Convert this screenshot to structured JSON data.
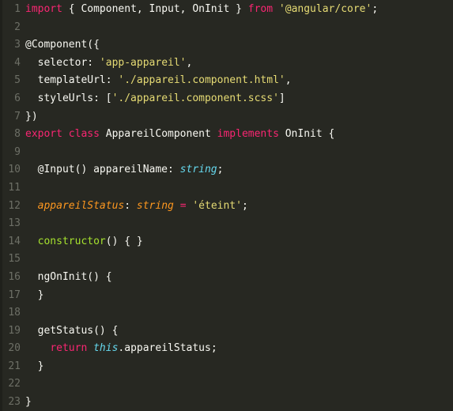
{
  "editor": {
    "language": "TypeScript",
    "theme": "Monokai",
    "colors": {
      "background": "#272822",
      "gutter_text": "#6d6f66",
      "foreground": "#f8f8f2",
      "keyword": "#f92672",
      "string": "#e6db74",
      "type": "#66d9ef",
      "function": "#a6e22e",
      "parameter": "#fd971f"
    },
    "total_lines": 23
  },
  "lines": [
    {
      "number": "1",
      "tokens": [
        {
          "text": "import ",
          "type": "keyword"
        },
        {
          "text": "{ Component, Input, OnInit } ",
          "type": "plain"
        },
        {
          "text": "from ",
          "type": "keyword"
        },
        {
          "text": "'@angular/core'",
          "type": "string"
        },
        {
          "text": ";",
          "type": "plain"
        }
      ]
    },
    {
      "number": "2",
      "tokens": []
    },
    {
      "number": "3",
      "tokens": [
        {
          "text": "@Component({",
          "type": "plain"
        }
      ]
    },
    {
      "number": "4",
      "tokens": [
        {
          "text": "  selector: ",
          "type": "plain"
        },
        {
          "text": "'app-appareil'",
          "type": "string"
        },
        {
          "text": ",",
          "type": "plain"
        }
      ]
    },
    {
      "number": "5",
      "tokens": [
        {
          "text": "  templateUrl: ",
          "type": "plain"
        },
        {
          "text": "'./appareil.component.html'",
          "type": "string"
        },
        {
          "text": ",",
          "type": "plain"
        }
      ]
    },
    {
      "number": "6",
      "tokens": [
        {
          "text": "  styleUrls: [",
          "type": "plain"
        },
        {
          "text": "'./appareil.component.scss'",
          "type": "string"
        },
        {
          "text": "]",
          "type": "plain"
        }
      ]
    },
    {
      "number": "7",
      "tokens": [
        {
          "text": "})",
          "type": "plain"
        }
      ]
    },
    {
      "number": "8",
      "tokens": [
        {
          "text": "export class ",
          "type": "keyword"
        },
        {
          "text": "AppareilComponent ",
          "type": "plain"
        },
        {
          "text": "implements ",
          "type": "keyword"
        },
        {
          "text": "OnInit {",
          "type": "plain"
        }
      ]
    },
    {
      "number": "9",
      "tokens": []
    },
    {
      "number": "10",
      "tokens": [
        {
          "text": "  @Input() appareilName: ",
          "type": "plain"
        },
        {
          "text": "string",
          "type": "type"
        },
        {
          "text": ";",
          "type": "plain"
        }
      ]
    },
    {
      "number": "11",
      "tokens": []
    },
    {
      "number": "12",
      "tokens": [
        {
          "text": "  ",
          "type": "plain"
        },
        {
          "text": "appareilStatus",
          "type": "param"
        },
        {
          "text": ": ",
          "type": "plain"
        },
        {
          "text": "string ",
          "type": "param"
        },
        {
          "text": "= ",
          "type": "operator"
        },
        {
          "text": "'éteint'",
          "type": "string"
        },
        {
          "text": ";",
          "type": "plain"
        }
      ]
    },
    {
      "number": "13",
      "tokens": []
    },
    {
      "number": "14",
      "tokens": [
        {
          "text": "  ",
          "type": "plain"
        },
        {
          "text": "constructor",
          "type": "func"
        },
        {
          "text": "() { }",
          "type": "plain"
        }
      ]
    },
    {
      "number": "15",
      "tokens": []
    },
    {
      "number": "16",
      "tokens": [
        {
          "text": "  ngOnInit() {",
          "type": "plain"
        }
      ]
    },
    {
      "number": "17",
      "tokens": [
        {
          "text": "  }",
          "type": "plain"
        }
      ]
    },
    {
      "number": "18",
      "tokens": []
    },
    {
      "number": "19",
      "tokens": [
        {
          "text": "  getStatus() {",
          "type": "plain"
        }
      ]
    },
    {
      "number": "20",
      "tokens": [
        {
          "text": "    ",
          "type": "plain"
        },
        {
          "text": "return ",
          "type": "keyword"
        },
        {
          "text": "this",
          "type": "type"
        },
        {
          "text": ".appareilStatus;",
          "type": "plain"
        }
      ]
    },
    {
      "number": "21",
      "tokens": [
        {
          "text": "  }",
          "type": "plain"
        }
      ]
    },
    {
      "number": "22",
      "tokens": []
    },
    {
      "number": "23",
      "tokens": [
        {
          "text": "}",
          "type": "plain"
        }
      ]
    }
  ]
}
